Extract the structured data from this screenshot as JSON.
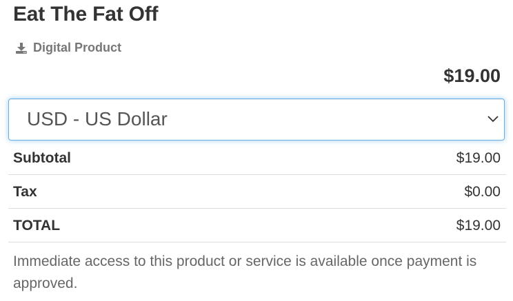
{
  "product": {
    "title": "Eat The Fat Off",
    "type_label": "Digital Product",
    "type_icon": "download-icon",
    "price": "$19.00"
  },
  "currency": {
    "selected": "USD - US Dollar"
  },
  "totals": [
    {
      "label": "Subtotal",
      "amount": "$19.00"
    },
    {
      "label": "Tax",
      "amount": "$0.00"
    },
    {
      "label": "TOTAL",
      "amount": "$19.00"
    }
  ],
  "note": "Immediate access to this product or service is available once payment is approved.",
  "colors": {
    "focus_border": "#66afe9",
    "text": "#333333",
    "muted": "#777777"
  }
}
